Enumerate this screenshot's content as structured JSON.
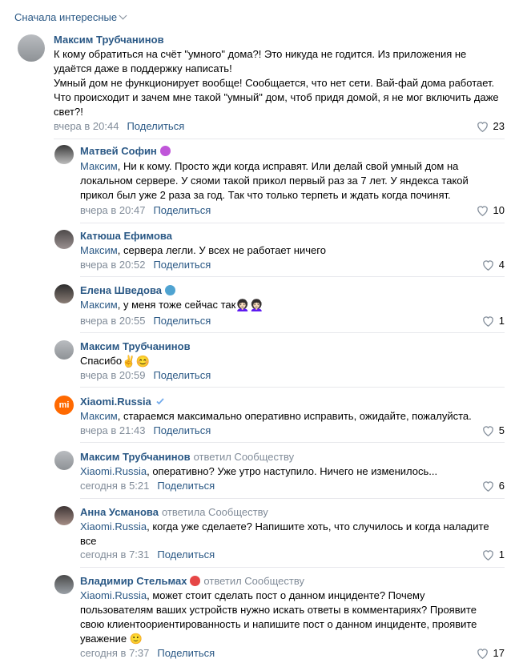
{
  "sort_label": "Сначала интересные",
  "share_label": "Поделиться",
  "comments": [
    {
      "author": "Максим Трубчанинов",
      "replied": "",
      "mention": "",
      "text": "К кому обратиться на счёт \"умного\" дома?! Это никуда не годится. Из приложения не удаётся даже в поддержку написать!\nУмный дом не функционирует вообще! Сообщается, что нет сети. Вай-фай дома работает. Что происходит и зачем мне такой \"умный\" дом, чтоб придя домой, я не мог включить даже свет?!",
      "time": "вчера в 20:44",
      "likes": "23"
    },
    {
      "author": "Матвей Софин",
      "replied": "",
      "mention": "Максим",
      "text": ", Ни к кому. Просто жди когда исправят. Или делай свой умный дом на локальном сервере. У сяоми такой прикол первый раз за 7 лет. У яндекса такой прикол был уже 2 раза за год. Так что только терпеть и ждать когда починят.",
      "time": "вчера в 20:47",
      "likes": "10"
    },
    {
      "author": "Катюша Ефимова",
      "replied": "",
      "mention": "Максим",
      "text": ", сервера легли. У всех не работает ничего",
      "time": "вчера в 20:52",
      "likes": "4"
    },
    {
      "author": "Елена Шведова",
      "replied": "",
      "mention": "Максим",
      "text": ", у меня тоже сейчас так",
      "time": "вчера в 20:55",
      "likes": "1"
    },
    {
      "author": "Максим Трубчанинов",
      "replied": "",
      "mention": "",
      "text": "Спасибо",
      "time": "вчера в 20:59",
      "likes": ""
    },
    {
      "author": "Xiaomi.Russia",
      "replied": "",
      "mention": "Максим",
      "text": ", стараемся максимально оперативно исправить, ожидайте, пожалуйста.",
      "time": "вчера в 21:43",
      "likes": "5"
    },
    {
      "author": "Максим Трубчанинов",
      "replied": "ответил Сообществу",
      "mention": "Xiaomi.Russia",
      "text": ", оперативно? Уже утро наступило. Ничего не изменилось...",
      "time": "сегодня в 5:21",
      "likes": "6"
    },
    {
      "author": "Анна Усманова",
      "replied": "ответила Сообществу",
      "mention": "Xiaomi.Russia",
      "text": ", когда уже сделаете? Напишите хоть, что случилось и когда наладите все",
      "time": "сегодня в 7:31",
      "likes": "1"
    },
    {
      "author": "Владимир Стельмах",
      "replied": "ответил Сообществу",
      "mention": "Xiaomi.Russia",
      "text": ", может стоит сделать пост о данном инциденте? Почему пользователям ваших устройств нужно искать ответы в комментариях? Проявите свою клиентоориентированность и напишите пост о данном инциденте, проявите уважение 🙂",
      "time": "сегодня в 7:37",
      "likes": "17"
    }
  ],
  "xiaomi_logo": "mi",
  "colors": {
    "link": "#2a5885",
    "meta": "#818c99",
    "divider": "#e7e8ec",
    "xiaomi": "#ff6900"
  }
}
